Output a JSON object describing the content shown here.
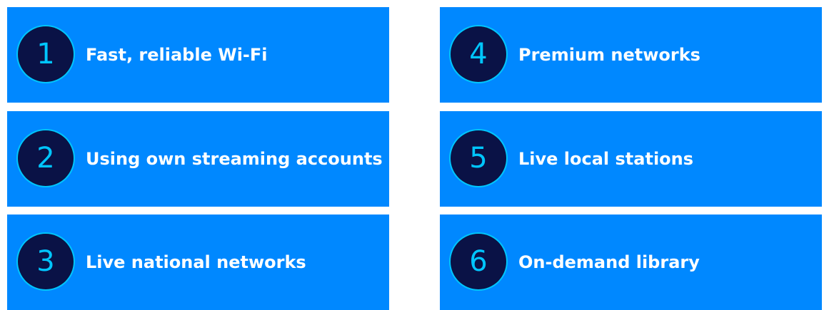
{
  "colors": {
    "card_background": "#0088ff",
    "badge_fill": "#0a1246",
    "badge_ring_and_number": "#00c6ff",
    "label_text": "#ffffff"
  },
  "items": [
    {
      "number": "1",
      "label": "Fast, reliable Wi-Fi"
    },
    {
      "number": "2",
      "label": "Using own streaming accounts"
    },
    {
      "number": "3",
      "label": "Live national networks"
    },
    {
      "number": "4",
      "label": "Premium networks"
    },
    {
      "number": "5",
      "label": "Live local stations"
    },
    {
      "number": "6",
      "label": "On-demand library"
    }
  ]
}
